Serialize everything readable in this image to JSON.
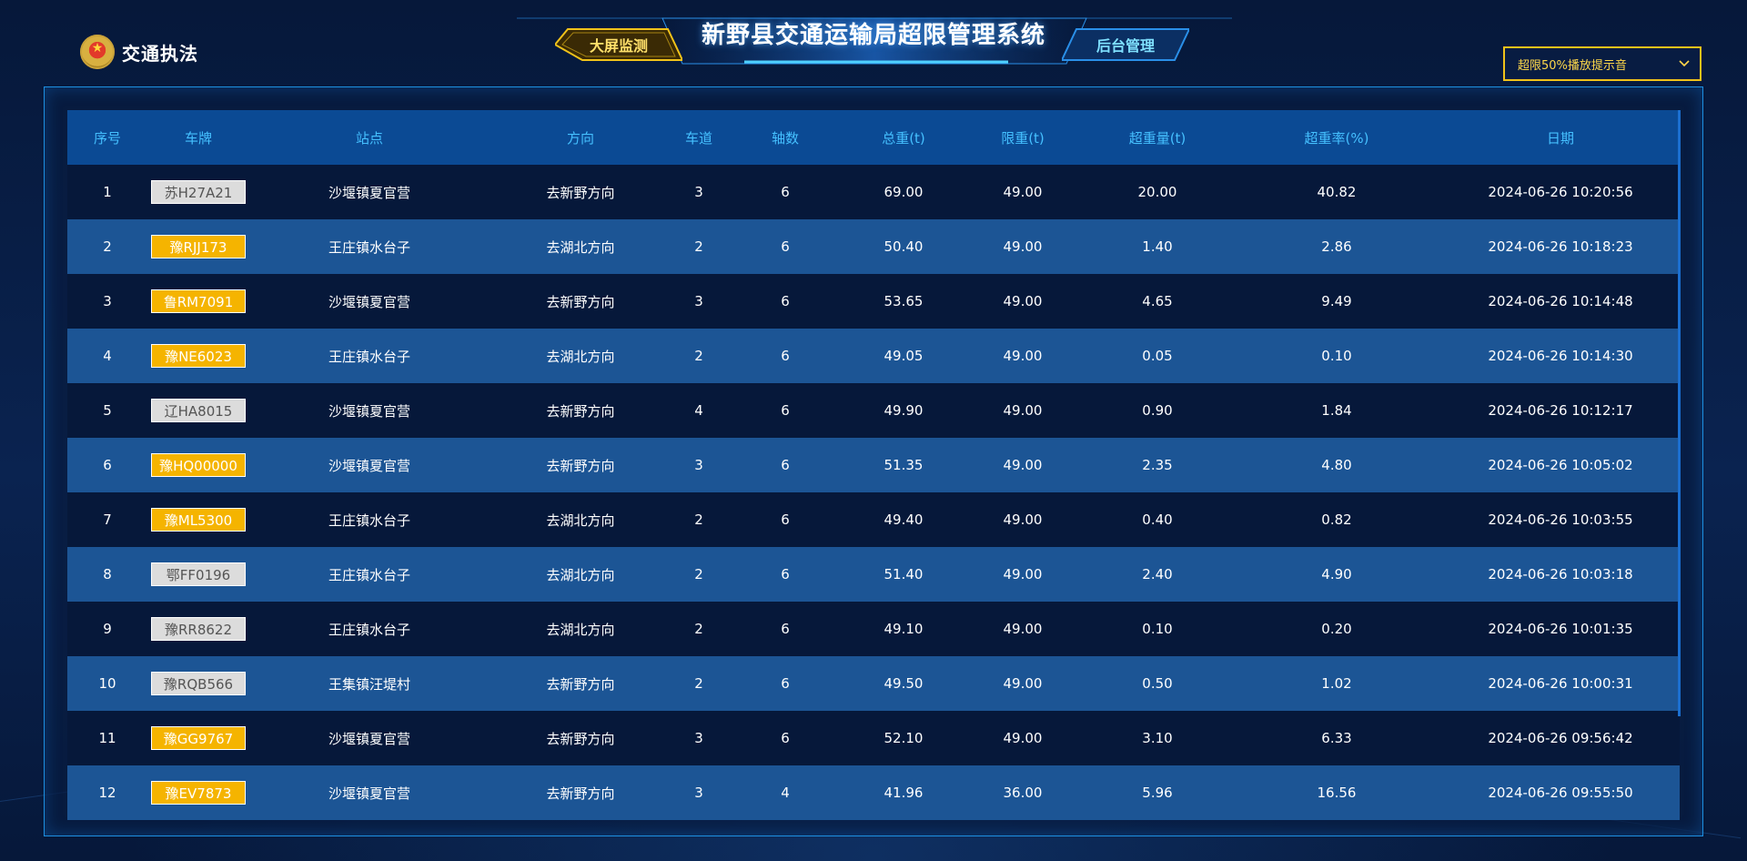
{
  "header": {
    "brand": "交通执法",
    "title": "新野县交通运输局超限管理系统",
    "tab_active": "大屏监测",
    "tab_inactive": "后台管理",
    "sound_select": "超限50%播放提示音"
  },
  "colors": {
    "accent_yellow": "#f0c21a",
    "header_text": "#45c0ff",
    "plate_yellow": "#f5b400",
    "plate_white": "#dcdcdc"
  },
  "table": {
    "columns": [
      "序号",
      "车牌",
      "站点",
      "方向",
      "车道",
      "轴数",
      "总重(t)",
      "限重(t)",
      "超重量(t)",
      "超重率(%)",
      "日期"
    ],
    "rows": [
      {
        "no": "1",
        "plate": "苏H27A21",
        "plate_color": "white",
        "station": "沙堰镇夏官营",
        "direction": "去新野方向",
        "lane": "3",
        "axles": "6",
        "total": "69.00",
        "limit": "49.00",
        "over": "20.00",
        "rate": "40.82",
        "date": "2024-06-26 10:20:56"
      },
      {
        "no": "2",
        "plate": "豫RJJ173",
        "plate_color": "yellow",
        "station": "王庄镇水台子",
        "direction": "去湖北方向",
        "lane": "2",
        "axles": "6",
        "total": "50.40",
        "limit": "49.00",
        "over": "1.40",
        "rate": "2.86",
        "date": "2024-06-26 10:18:23"
      },
      {
        "no": "3",
        "plate": "鲁RM7091",
        "plate_color": "yellow",
        "station": "沙堰镇夏官营",
        "direction": "去新野方向",
        "lane": "3",
        "axles": "6",
        "total": "53.65",
        "limit": "49.00",
        "over": "4.65",
        "rate": "9.49",
        "date": "2024-06-26 10:14:48"
      },
      {
        "no": "4",
        "plate": "豫NE6023",
        "plate_color": "yellow",
        "station": "王庄镇水台子",
        "direction": "去湖北方向",
        "lane": "2",
        "axles": "6",
        "total": "49.05",
        "limit": "49.00",
        "over": "0.05",
        "rate": "0.10",
        "date": "2024-06-26 10:14:30"
      },
      {
        "no": "5",
        "plate": "辽HA8015",
        "plate_color": "white",
        "station": "沙堰镇夏官营",
        "direction": "去新野方向",
        "lane": "4",
        "axles": "6",
        "total": "49.90",
        "limit": "49.00",
        "over": "0.90",
        "rate": "1.84",
        "date": "2024-06-26 10:12:17"
      },
      {
        "no": "6",
        "plate": "豫HQ00000",
        "plate_color": "yellow",
        "station": "沙堰镇夏官营",
        "direction": "去新野方向",
        "lane": "3",
        "axles": "6",
        "total": "51.35",
        "limit": "49.00",
        "over": "2.35",
        "rate": "4.80",
        "date": "2024-06-26 10:05:02"
      },
      {
        "no": "7",
        "plate": "豫ML5300",
        "plate_color": "yellow",
        "station": "王庄镇水台子",
        "direction": "去湖北方向",
        "lane": "2",
        "axles": "6",
        "total": "49.40",
        "limit": "49.00",
        "over": "0.40",
        "rate": "0.82",
        "date": "2024-06-26 10:03:55"
      },
      {
        "no": "8",
        "plate": "鄂FF0196",
        "plate_color": "white",
        "station": "王庄镇水台子",
        "direction": "去湖北方向",
        "lane": "2",
        "axles": "6",
        "total": "51.40",
        "limit": "49.00",
        "over": "2.40",
        "rate": "4.90",
        "date": "2024-06-26 10:03:18"
      },
      {
        "no": "9",
        "plate": "豫RR8622",
        "plate_color": "white",
        "station": "王庄镇水台子",
        "direction": "去湖北方向",
        "lane": "2",
        "axles": "6",
        "total": "49.10",
        "limit": "49.00",
        "over": "0.10",
        "rate": "0.20",
        "date": "2024-06-26 10:01:35"
      },
      {
        "no": "10",
        "plate": "豫RQB566",
        "plate_color": "white",
        "station": "王集镇汪堤村",
        "direction": "去新野方向",
        "lane": "2",
        "axles": "6",
        "total": "49.50",
        "limit": "49.00",
        "over": "0.50",
        "rate": "1.02",
        "date": "2024-06-26 10:00:31"
      },
      {
        "no": "11",
        "plate": "豫GG9767",
        "plate_color": "yellow",
        "station": "沙堰镇夏官营",
        "direction": "去新野方向",
        "lane": "3",
        "axles": "6",
        "total": "52.10",
        "limit": "49.00",
        "over": "3.10",
        "rate": "6.33",
        "date": "2024-06-26 09:56:42"
      },
      {
        "no": "12",
        "plate": "豫EV7873",
        "plate_color": "yellow",
        "station": "沙堰镇夏官营",
        "direction": "去新野方向",
        "lane": "3",
        "axles": "4",
        "total": "41.96",
        "limit": "36.00",
        "over": "5.96",
        "rate": "16.56",
        "date": "2024-06-26 09:55:50"
      }
    ]
  }
}
